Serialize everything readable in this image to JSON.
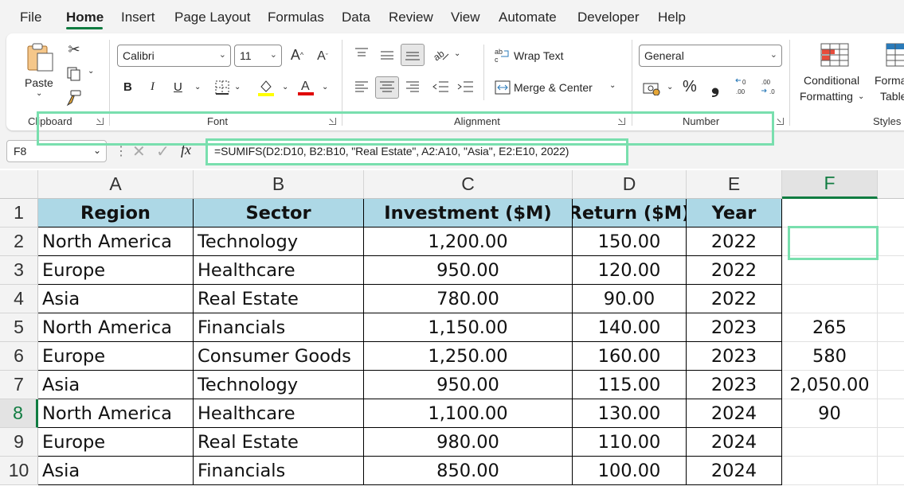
{
  "menu": {
    "tabs": [
      "File",
      "Home",
      "Insert",
      "Page Layout",
      "Formulas",
      "Data",
      "Review",
      "View",
      "Automate",
      "Developer",
      "Help"
    ],
    "active_tab": "Home"
  },
  "ribbon": {
    "clipboard": {
      "paste_label": "Paste",
      "group_label": "Clipboard"
    },
    "font": {
      "font_name": "Calibri",
      "font_size": "11",
      "group_label": "Font",
      "bold": "B",
      "italic": "I",
      "underline": "U"
    },
    "alignment": {
      "wrap_text": "Wrap Text",
      "merge_center": "Merge & Center",
      "group_label": "Alignment"
    },
    "number": {
      "format": "General",
      "percent": "%",
      "comma": "❟",
      "group_label": "Number"
    },
    "styles": {
      "conditional_formatting_line1": "Conditional",
      "conditional_formatting_line2": "Formatting",
      "format_table_line1": "Forma",
      "format_table_line2": "Table",
      "group_label": "Styles"
    },
    "colors": {
      "highlight": "#ffff00",
      "font_color": "#e00000",
      "accent": "#107c41",
      "highlight_box": "#79dfae"
    }
  },
  "formula_bar": {
    "name_box": "F8",
    "fx": "fx",
    "formula": "=SUMIFS(D2:D10, B2:B10, \"Real Estate\", A2:A10, \"Asia\", E2:E10, 2022)"
  },
  "sheet": {
    "columns": [
      "A",
      "B",
      "C",
      "D",
      "E",
      "F"
    ],
    "rows": [
      "1",
      "2",
      "3",
      "4",
      "5",
      "6",
      "7",
      "8",
      "9",
      "10"
    ],
    "headers": [
      "Region",
      "Sector",
      "Investment ($M)",
      "Return ($M)",
      "Year"
    ],
    "data": [
      [
        "North America",
        "Technology",
        "1,200.00",
        "150.00",
        "2022",
        ""
      ],
      [
        "Europe",
        "Healthcare",
        "950.00",
        "120.00",
        "2022",
        ""
      ],
      [
        "Asia",
        "Real Estate",
        "780.00",
        "90.00",
        "2022",
        ""
      ],
      [
        "North America",
        "Financials",
        "1,150.00",
        "140.00",
        "2023",
        "265"
      ],
      [
        "Europe",
        "Consumer Goods",
        "1,250.00",
        "160.00",
        "2023",
        "580"
      ],
      [
        "Asia",
        "Technology",
        "950.00",
        "115.00",
        "2023",
        "2,050.00"
      ],
      [
        "North America",
        "Healthcare",
        "1,100.00",
        "130.00",
        "2024",
        "90"
      ],
      [
        "Europe",
        "Real Estate",
        "980.00",
        "110.00",
        "2024",
        ""
      ],
      [
        "Asia",
        "Financials",
        "850.00",
        "100.00",
        "2024",
        ""
      ]
    ],
    "selected_cell": "F8",
    "header_fill": "#add8e6"
  }
}
